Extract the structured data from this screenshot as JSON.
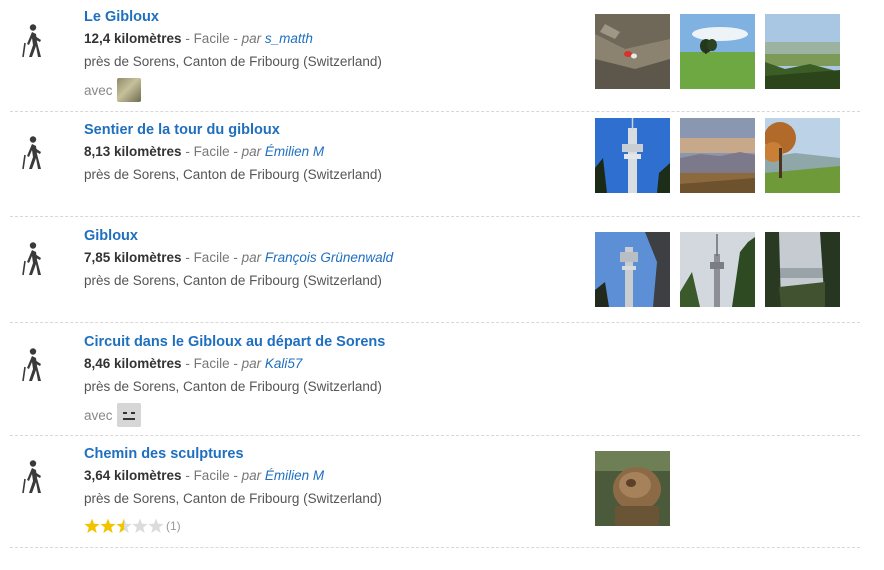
{
  "with_label": "avec",
  "by_label": "par",
  "items": [
    {
      "title": "Le Gibloux",
      "distance": "12,4 kilomètres",
      "difficulty": "Facile",
      "author": "s_matth",
      "location": "près de Sorens, Canton de Fribourg (Switzerland)",
      "companion": "photo"
    },
    {
      "title": "Sentier de la tour du gibloux",
      "distance": "8,13 kilomètres",
      "difficulty": "Facile",
      "author": "Émilien M",
      "location": "près de Sorens, Canton de Fribourg (Switzerland)"
    },
    {
      "title": "Gibloux",
      "distance": "7,85 kilomètres",
      "difficulty": "Facile",
      "author": "François Grünenwald",
      "location": "près de Sorens, Canton de Fribourg (Switzerland)"
    },
    {
      "title": "Circuit dans le Gibloux au départ de Sorens",
      "distance": "8,46 kilomètres",
      "difficulty": "Facile",
      "author": "Kali57",
      "location": "près de Sorens, Canton de Fribourg (Switzerland)",
      "companion": "face"
    },
    {
      "title": "Chemin des sculptures",
      "distance": "3,64 kilomètres",
      "difficulty": "Facile",
      "author": "Émilien M",
      "location": "près de Sorens, Canton de Fribourg (Switzerland)",
      "rating": {
        "stars": 2.5,
        "max": 5,
        "count": "(1)"
      }
    }
  ],
  "colors": {
    "link": "#1f6fbf",
    "star": "#f2c400",
    "star_empty": "#dcdcdc"
  }
}
